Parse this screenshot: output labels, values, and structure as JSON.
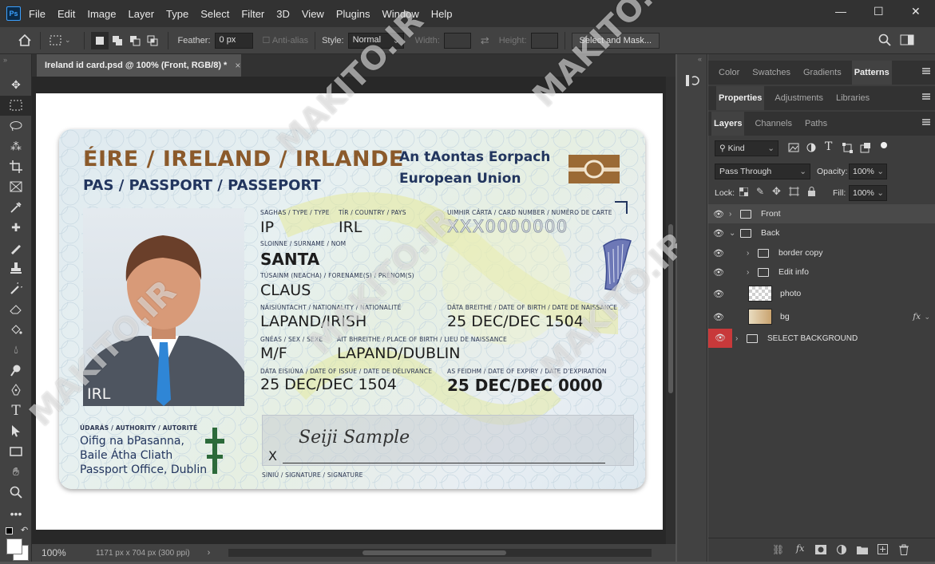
{
  "app": {
    "logo": "Ps"
  },
  "menu": [
    "File",
    "Edit",
    "Image",
    "Layer",
    "Type",
    "Select",
    "Filter",
    "3D",
    "View",
    "Plugins",
    "Window",
    "Help"
  ],
  "window_controls": {
    "minimize": "—",
    "maximize": "☐",
    "close": "✕"
  },
  "options": {
    "feather_label": "Feather:",
    "feather_value": "0 px",
    "antialias_label": "Anti-alias",
    "style_label": "Style:",
    "style_value": "Normal",
    "width_label": "Width:",
    "height_label": "Height:",
    "select_mask": "Select and Mask..."
  },
  "document": {
    "tab_title": "Ireland id card.psd @ 100% (Front, RGB/8) *",
    "close": "×",
    "zoom": "100%",
    "doc_info": "1171 px x 704 px (300 ppi)"
  },
  "card": {
    "title1": "ÉIRE / IRELAND / IRLANDE",
    "title2": "PAS / PASSPORT / PASSEPORT",
    "eu1": "An tAontas Eorpach",
    "eu2": "European Union",
    "photo_label": "IRL",
    "type_label": "SAGHAS / TYPE / TYPE",
    "type_value": "IP",
    "country_label": "TÍR / COUNTRY / PAYS",
    "country_value": "IRL",
    "cardno_label": "UIMHIR CÁRTA / CARD NUMBER / NUMÉRO DE CARTE",
    "cardno_value": "XXX0000000",
    "surname_label": "SLOINNE / SURNAME / NOM",
    "surname_value": "SANTA",
    "forename_label": "TÚSAINM (NEACHA) / FORENAME(S) / PRÉNOM(S)",
    "forename_value": "CLAUS",
    "nationality_label": "NÁISIÚNTACHT / NATIONALITY / NATIONALITÉ",
    "nationality_value": "LAPAND/IRISH",
    "dob_label": "DÁTA BREITHE / DATE OF BIRTH / DATE DE NAISSANCE",
    "dob_value": "25 DEC/DEC 1504",
    "sex_label": "GNÉAS / SEX / SEXE",
    "sex_value": "M/F",
    "pob_label": "ÁIT BHREITHE / PLACE OF BIRTH / LIEU DE NAISSANCE",
    "pob_value": "LAPAND/DUBLIN",
    "issue_label": "DÁTA EISIÚNA / DATE OF ISSUE / DATE DE DÉLIVRANCE",
    "issue_value": "25 DEC/DEC 1504",
    "expiry_label": "AS FEIDHM / DATE OF EXPIRY / DATE D'EXPIRATION",
    "expiry_value": "25 DEC/DEC 0000",
    "authority_label": "ÚDARÁS / AUTHORITY / AUTORITÉ",
    "authority_line1": "Oifig na bPasanna,",
    "authority_line2": "Baile Átha Cliath",
    "authority_line3": "Passport Office, Dublin",
    "signature_mark": "X",
    "signature_text": "Seiji Sample",
    "signature_label": "SINIÚ / SIGNATURE / SIGNATURE"
  },
  "panels": {
    "row1_tabs": [
      "Color",
      "Swatches",
      "Gradients",
      "Patterns"
    ],
    "row2_tabs": [
      "Properties",
      "Adjustments",
      "Libraries"
    ],
    "row3_tabs": [
      "Layers",
      "Channels",
      "Paths"
    ],
    "kind_label": "Kind",
    "blend_mode": "Pass Through",
    "opacity_label": "Opacity:",
    "opacity_value": "100%",
    "lock_label": "Lock:",
    "fill_label": "Fill:",
    "fill_value": "100%",
    "layers": [
      {
        "name": "Front"
      },
      {
        "name": "Back"
      },
      {
        "name": "border copy"
      },
      {
        "name": "Edit info"
      },
      {
        "name": "photo"
      },
      {
        "name": "bg",
        "fx": "fx"
      },
      {
        "name": "SELECT BACKGROUND"
      }
    ]
  },
  "watermark": "MAKITO.IR",
  "colors": {
    "accent_red": "#c8393a",
    "card_brown": "#8b5a2b",
    "card_navy": "#22355e"
  }
}
